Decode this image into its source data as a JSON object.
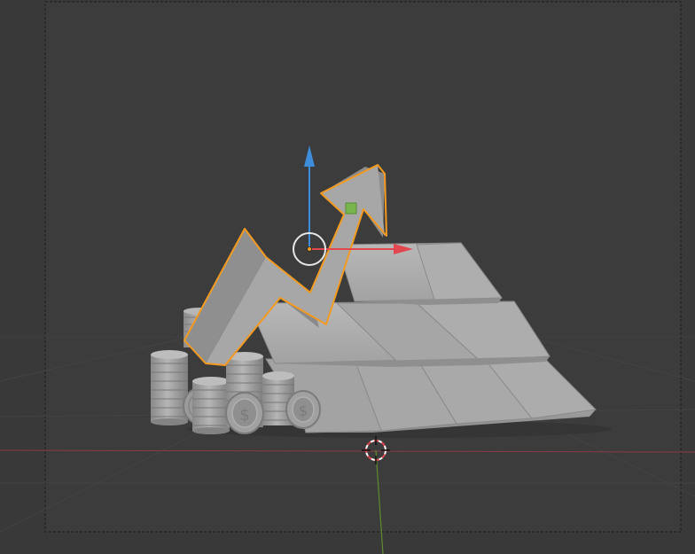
{
  "app": "3d-viewport",
  "colors": {
    "background": "#393939",
    "camera_frame_fill": "#3c3c3c",
    "grid_line": "#434343",
    "x_axis_line": "#8a3b45",
    "y_axis_line": "#5f8a2e",
    "selection_outline": "#f39a21",
    "gizmo_x": "#e2474f",
    "gizmo_z": "#3d8ddb",
    "gizmo_plane": "#79b54d",
    "mesh_light": "#b2b2b2",
    "mesh_mid": "#999999",
    "mesh_dark": "#7d7d7d"
  },
  "scene": {
    "objects": [
      {
        "id": "arrow",
        "name": "trend-arrow",
        "selected": true
      },
      {
        "id": "bars",
        "name": "gold-bar-pyramid",
        "selected": false
      },
      {
        "id": "coins",
        "name": "coin-stacks",
        "selected": false
      }
    ],
    "overlays": {
      "camera_frame": true,
      "floor_grid": true,
      "axis_lines": [
        "x",
        "y"
      ],
      "transform_gizmo": "move",
      "cursor_3d": true
    },
    "coin_symbol": "$"
  }
}
